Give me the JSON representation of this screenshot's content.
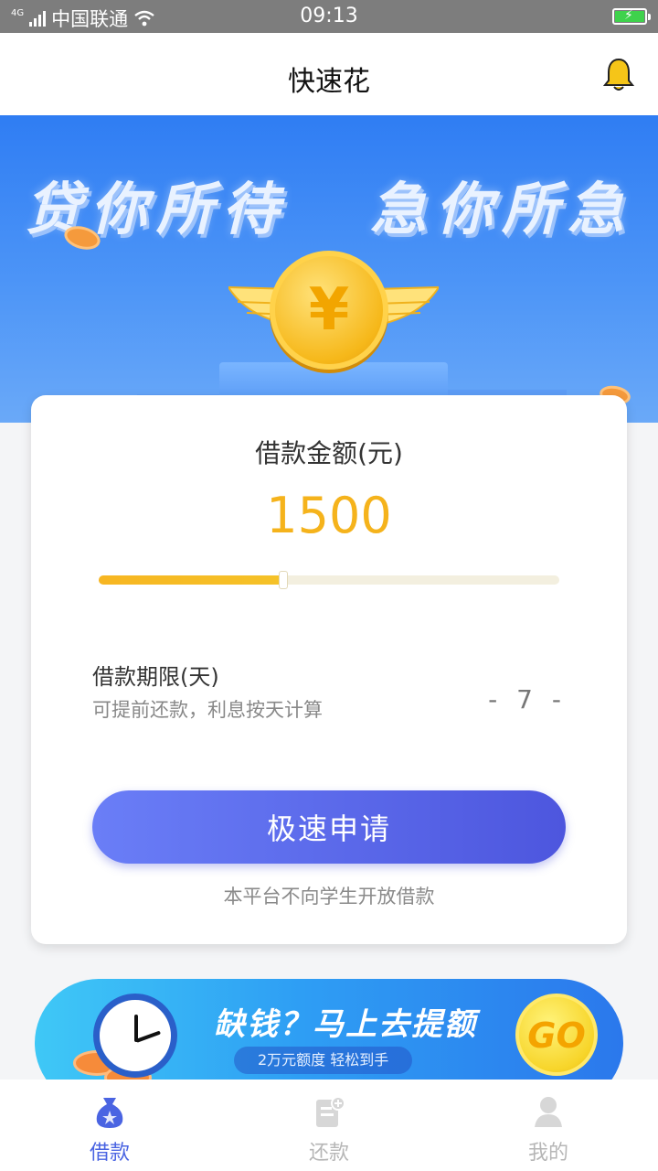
{
  "status_bar": {
    "network_type": "4G",
    "carrier": "中国联通",
    "time": "09:13"
  },
  "header": {
    "title": "快速花",
    "icon": "bell-icon",
    "accent_color": "#f5c518"
  },
  "banner": {
    "slogan_left": "贷你所待",
    "slogan_right": "急你所急",
    "coin_symbol": "¥"
  },
  "loan_card": {
    "amount_label": "借款金额(元)",
    "amount_value": "1500",
    "amount_slider_fraction": 0.4,
    "term_label": "借款期限(天)",
    "term_hint": "可提前还款，利息按天计算",
    "term_value": "- 7 -",
    "apply_button": "极速申请",
    "notice": "本平台不向学生开放借款",
    "colors": {
      "amount": "#f5b31c",
      "button": "#5b6aec"
    }
  },
  "promo": {
    "title": "缺钱？马上去提额",
    "subtitle": "2万元额度 轻松到手",
    "go_label": "GO"
  },
  "bottom_nav": {
    "items": [
      {
        "label": "借款",
        "icon": "money-bag-icon",
        "active": true
      },
      {
        "label": "还款",
        "icon": "repay-document-icon",
        "active": false
      },
      {
        "label": "我的",
        "icon": "user-icon",
        "active": false
      }
    ],
    "active_color": "#4a64e2"
  }
}
